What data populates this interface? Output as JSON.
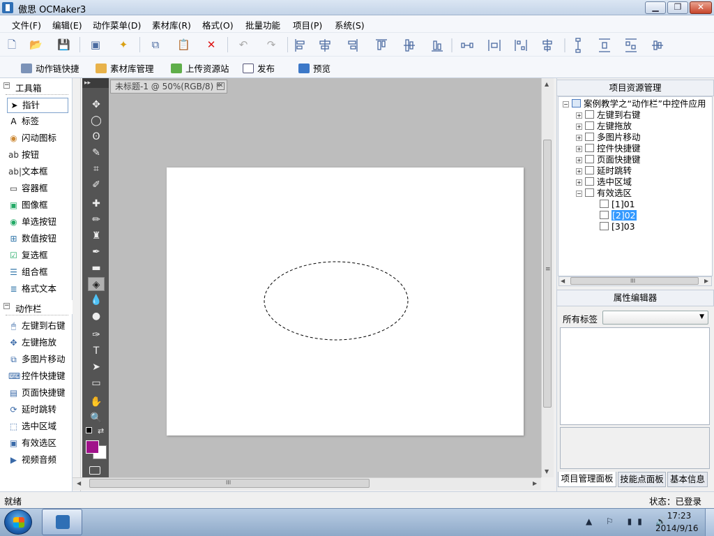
{
  "window": {
    "title": "傲思 OCMaker3",
    "btn_minimize": "▁",
    "btn_restore": "❐",
    "btn_close": "✕"
  },
  "menu": [
    "文件(F)",
    "编辑(E)",
    "动作菜单(D)",
    "素材库(R)",
    "格式(O)",
    "批量功能",
    "项目(P)",
    "系统(S)"
  ],
  "toolbar1_glyphs": {
    "new": "🗋",
    "open": "📂",
    "save": "💾",
    "cut_like": "▣",
    "puzzle": "✦",
    "copy": "⧉",
    "paste": "📋",
    "delete": "✕",
    "undo": "↶",
    "redo": "↷"
  },
  "toolbar2": [
    "动作链快捷",
    "素材库管理",
    "上传资源站",
    "发布",
    "预览"
  ],
  "toolbox": {
    "header": "工具箱",
    "collapse_glyph": "−",
    "items": [
      {
        "label": "指针",
        "glyph": "➤"
      },
      {
        "label": "标签",
        "glyph": "A"
      },
      {
        "label": "闪动图标",
        "glyph": "◉"
      },
      {
        "label": "按钮",
        "glyph": "ab"
      },
      {
        "label": "文本框",
        "glyph": "ab|"
      },
      {
        "label": "容器框",
        "glyph": "▭"
      },
      {
        "label": "图像框",
        "glyph": "▣"
      },
      {
        "label": "单选按钮",
        "glyph": "◉"
      },
      {
        "label": "数值按钮",
        "glyph": "⊞"
      },
      {
        "label": "复选框",
        "glyph": "☑"
      },
      {
        "label": "组合框",
        "glyph": "☰"
      },
      {
        "label": "格式文本",
        "glyph": "≣"
      }
    ]
  },
  "actionbar": {
    "header": "动作栏",
    "collapse_glyph": "−",
    "items": [
      {
        "label": "左键到右键",
        "glyph": "🖱"
      },
      {
        "label": "左键拖放",
        "glyph": "✥"
      },
      {
        "label": "多图片移动",
        "glyph": "⧉"
      },
      {
        "label": "控件快捷键",
        "glyph": "⌨"
      },
      {
        "label": "页面快捷键",
        "glyph": "▤"
      },
      {
        "label": "延时跳转",
        "glyph": "⟳"
      },
      {
        "label": "选中区域",
        "glyph": "⬚"
      },
      {
        "label": "有效选区",
        "glyph": "▣"
      },
      {
        "label": "视频音频",
        "glyph": "▶"
      }
    ]
  },
  "ps_tools": [
    "✥",
    "◯",
    "ʘ",
    "✎",
    "⌗",
    "✐",
    "✚",
    "✏",
    "♜",
    "✒",
    "▬",
    "◈",
    "💧",
    "●",
    "✑",
    "T",
    "➤",
    "▭",
    "✋",
    "🔍"
  ],
  "ps_top_glyph": "▸▸",
  "document": {
    "tab_title": "未标题-1 @ 50%(RGB/8) *",
    "tab_close": "✕"
  },
  "colors": {
    "foreground": "#a0128a",
    "background": "#ffffff",
    "selection_accent": "#3399ff"
  },
  "project_panel": {
    "title": "项目资源管理",
    "root": "案例教学之“动作栏”中控件应用",
    "nodes": [
      "左键到右键",
      "左键拖放",
      "多图片移动",
      "控件快捷键",
      "页面快捷键",
      "延时跳转",
      "选中区域",
      "有效选区"
    ],
    "children": [
      "[1]01",
      "[2]02",
      "[3]03"
    ],
    "scroll_grip": "III"
  },
  "property_panel": {
    "title": "属性编辑器",
    "filter_label": "所有标签",
    "filter_value": ""
  },
  "bottom_tabs": [
    "项目管理面板",
    "技能点面板",
    "基本信息"
  ],
  "status": {
    "ready": "就绪",
    "login": "状态：已登录"
  },
  "scroll_grips": {
    "horizontal": "III",
    "vertical": "≡"
  },
  "taskbar": {
    "tray": "▲ ⚐ ▮▮ 🔊",
    "time": "17:23",
    "date": "2014/9/16"
  }
}
